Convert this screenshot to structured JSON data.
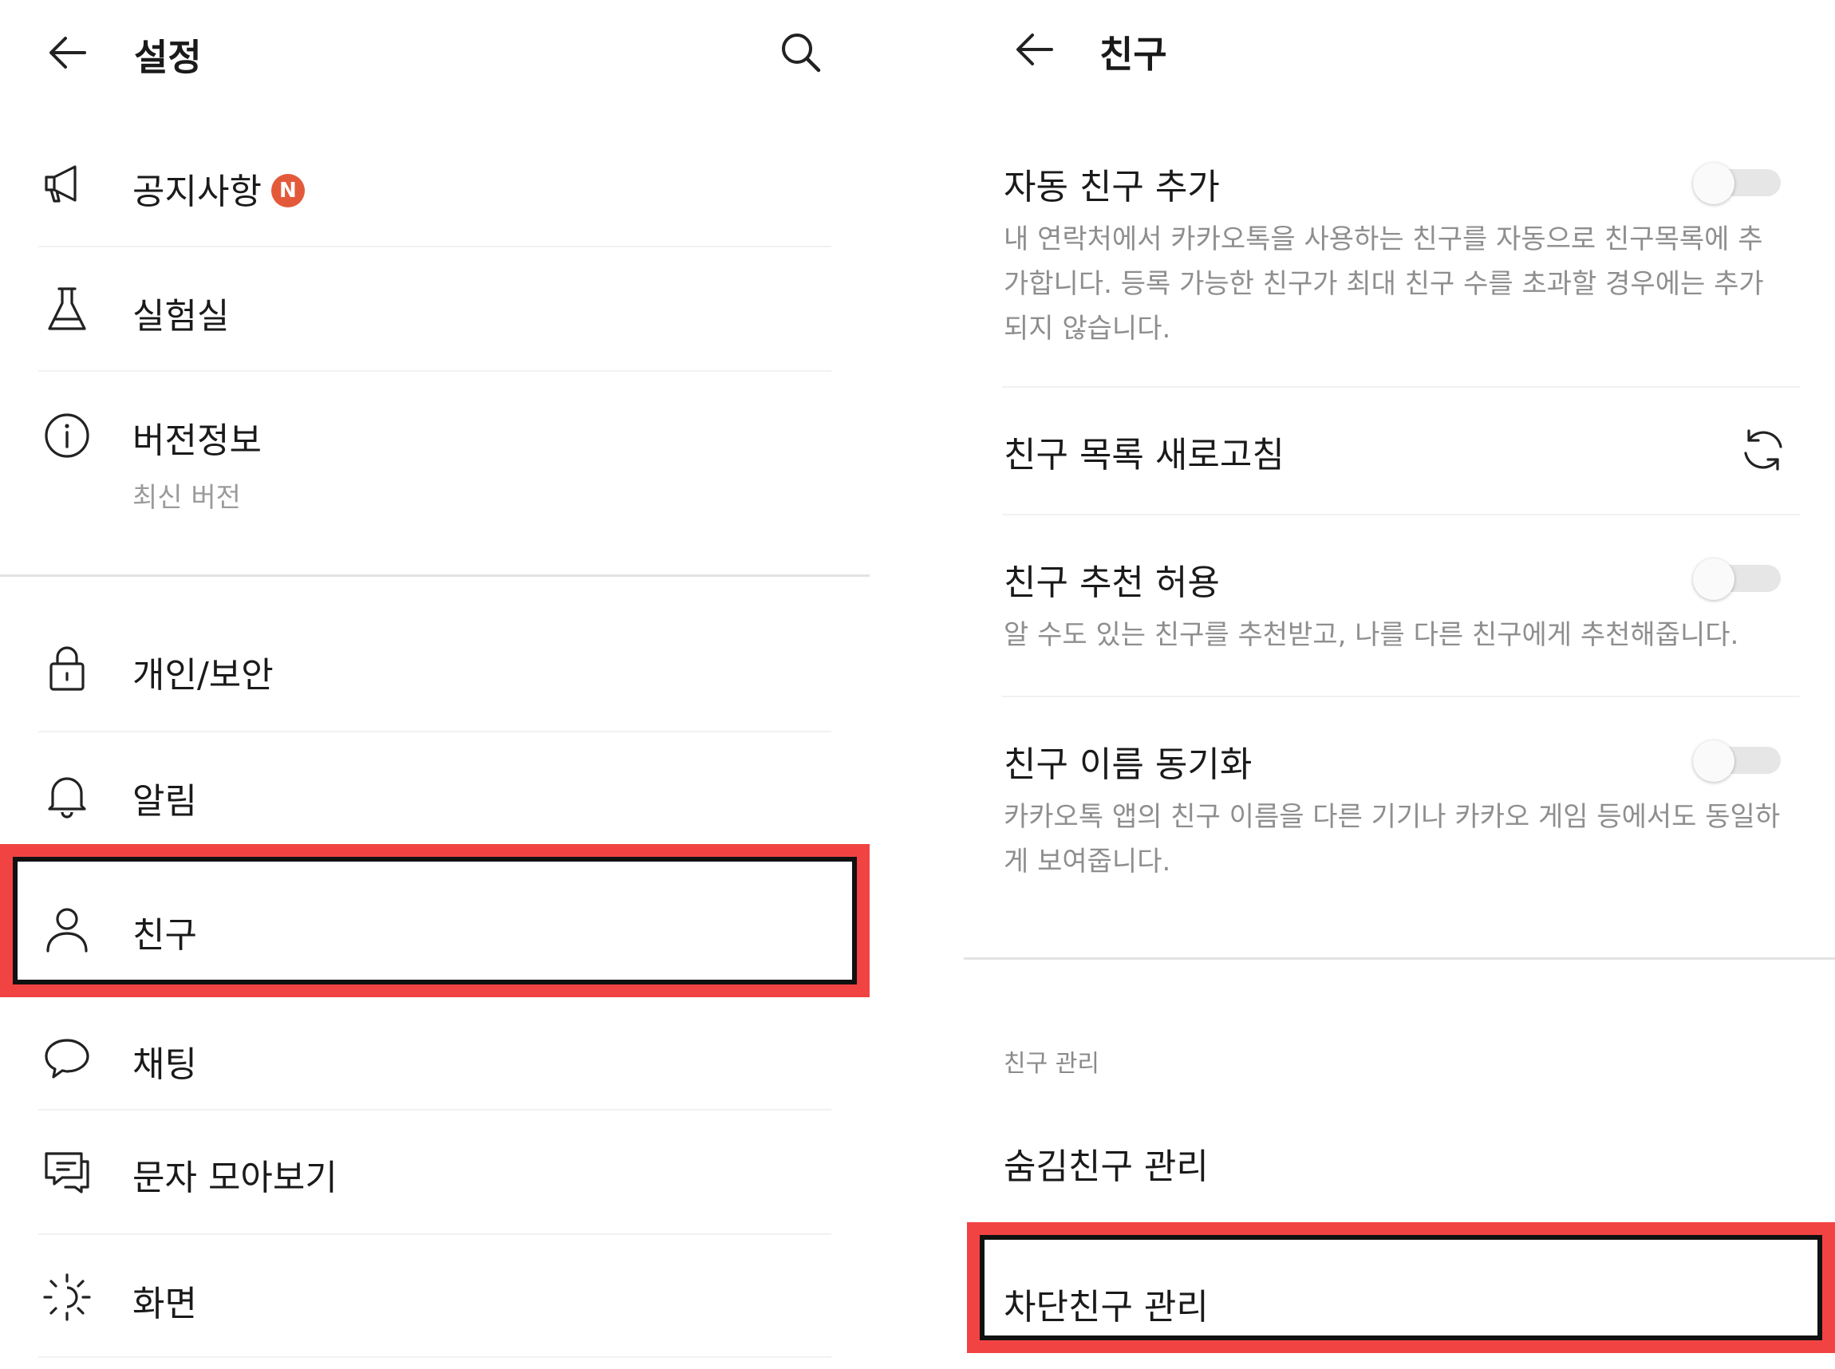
{
  "settings": {
    "title": "설정",
    "items": [
      {
        "label": "공지사항",
        "icon": "megaphone-icon",
        "badge": "N"
      },
      {
        "label": "실험실",
        "icon": "flask-icon"
      },
      {
        "label": "버전정보",
        "icon": "info-icon",
        "sub": "최신 버전"
      },
      {
        "label": "개인/보안",
        "icon": "lock-icon"
      },
      {
        "label": "알림",
        "icon": "bell-icon"
      },
      {
        "label": "친구",
        "icon": "person-icon",
        "highlighted": true
      },
      {
        "label": "채팅",
        "icon": "chat-bubble-icon"
      },
      {
        "label": "문자 모아보기",
        "icon": "message-icon"
      },
      {
        "label": "화면",
        "icon": "display-icon"
      }
    ]
  },
  "friends": {
    "title": "친구",
    "options": [
      {
        "label": "자동 친구 추가",
        "desc": "내 연락처에서 카카오톡을 사용하는 친구를 자동으로 친구목록에 추가합니다. 등록 가능한 친구가 최대 친구 수를 초과할 경우에는 추가되지 않습니다.",
        "enabled": false
      },
      {
        "label": "친구 목록 새로고침",
        "icon": "refresh-icon"
      },
      {
        "label": "친구 추천 허용",
        "desc": "알 수도 있는 친구를 추천받고, 나를 다른 친구에게 추천해줍니다.",
        "enabled": false
      },
      {
        "label": "친구 이름 동기화",
        "desc": "카카오톡 앱의 친구 이름을 다른 기기나 카카오 게임 등에서도 동일하게 보여줍니다.",
        "enabled": false
      }
    ],
    "section_header": "친구 관리",
    "manage": [
      {
        "label": "숨김친구 관리"
      },
      {
        "label": "차단친구 관리",
        "highlighted": true
      }
    ]
  },
  "colors": {
    "highlight": "#f24343",
    "badge": "#e35a3a"
  }
}
